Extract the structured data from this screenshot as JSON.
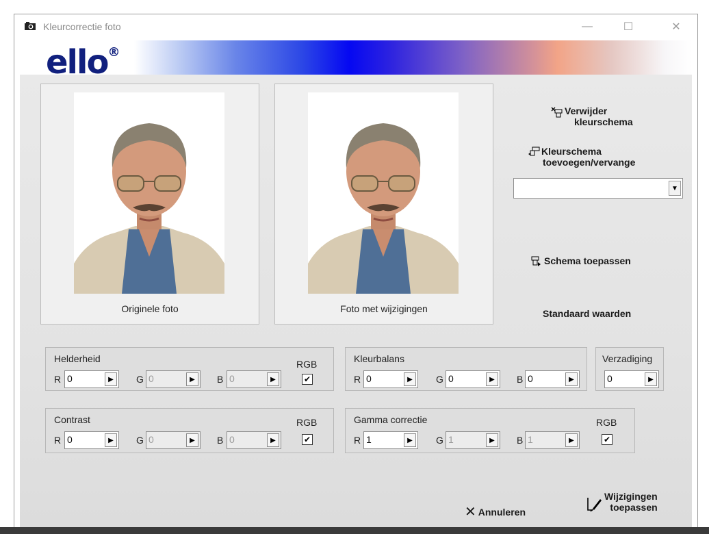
{
  "window": {
    "title": "Kleurcorrectie foto",
    "minimize": "—",
    "maximize": "☐",
    "close": "✕"
  },
  "banner": {
    "logo_text": "ello",
    "logo_mark": "®"
  },
  "photos": {
    "original_caption": "Originele foto",
    "modified_caption": "Foto met wijzigingen"
  },
  "actions": {
    "delete_scheme_line1": "Verwijder",
    "delete_scheme_line2": "kleurschema",
    "add_scheme_line1": "Kleurschema",
    "add_scheme_line2": "toevoegen/vervange",
    "scheme_select_value": "",
    "apply_scheme": "Schema toepassen",
    "default_values": "Standaard waarden"
  },
  "helderheid": {
    "title": "Helderheid",
    "r_label": "R",
    "r_value": "0",
    "g_label": "G",
    "g_value": "0",
    "b_label": "B",
    "b_value": "0",
    "rgb_label": "RGB",
    "rgb_checked": true
  },
  "kleurbalans": {
    "title": "Kleurbalans",
    "r_label": "R",
    "r_value": "0",
    "g_label": "G",
    "g_value": "0",
    "b_label": "B",
    "b_value": "0"
  },
  "verzadiging": {
    "title": "Verzadiging",
    "value": "0"
  },
  "contrast": {
    "title": "Contrast",
    "r_label": "R",
    "r_value": "0",
    "g_label": "G",
    "g_value": "0",
    "b_label": "B",
    "b_value": "0",
    "rgb_label": "RGB",
    "rgb_checked": true
  },
  "gamma": {
    "title": "Gamma correctie",
    "r_label": "R",
    "r_value": "1",
    "g_label": "G",
    "g_value": "1",
    "b_label": "B",
    "b_value": "1",
    "rgb_label": "RGB",
    "rgb_checked": true
  },
  "footer": {
    "cancel": "Annuleren",
    "apply_line1": "Wijzigingen",
    "apply_line2": "toepassen"
  },
  "icons": {
    "spin_arrow": "▶",
    "combo_arrow": "▼",
    "checkmark": "✔",
    "cancel_x": "✕"
  },
  "colors": {
    "logo": "#11207e",
    "banner_center": "#0508f2"
  }
}
